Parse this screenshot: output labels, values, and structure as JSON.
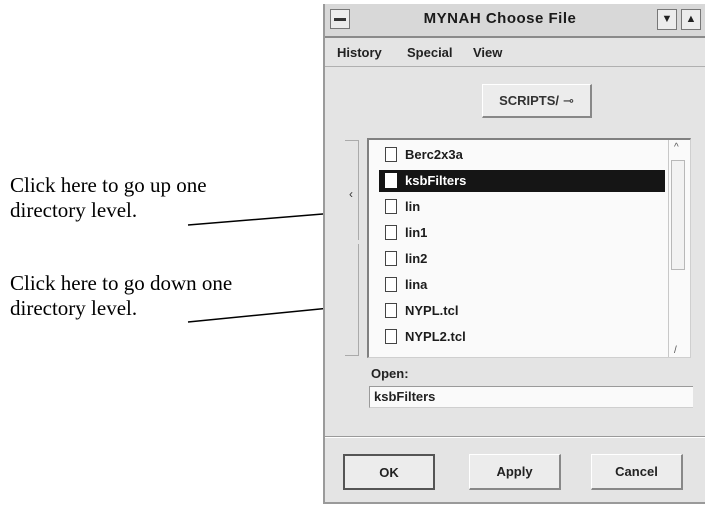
{
  "annotations": {
    "up": {
      "line1": "Click here to go up one",
      "line2": "directory level."
    },
    "down": {
      "line1": "Click here to go down one",
      "line2": "directory level."
    }
  },
  "window": {
    "title": "MYNAH Choose File",
    "icons": {
      "system_menu": "system-menu-icon",
      "minimize": "minimize-icon",
      "maximize": "maximize-icon"
    },
    "menus": [
      "History",
      "Special",
      "View"
    ],
    "directory_button": {
      "label": "SCRIPTS/",
      "icon": "dropdown-arrow-icon"
    },
    "files": [
      {
        "name": "Berc2x3a",
        "selected": false
      },
      {
        "name": "ksbFilters",
        "selected": true
      },
      {
        "name": "lin",
        "selected": false
      },
      {
        "name": "lin1",
        "selected": false
      },
      {
        "name": "lin2",
        "selected": false
      },
      {
        "name": "lina",
        "selected": false
      },
      {
        "name": "NYPL.tcl",
        "selected": false
      },
      {
        "name": "NYPL2.tcl",
        "selected": false
      }
    ],
    "open": {
      "label": "Open:",
      "value": "ksbFilters"
    },
    "buttons": {
      "ok": "OK",
      "apply": "Apply",
      "cancel": "Cancel"
    }
  }
}
